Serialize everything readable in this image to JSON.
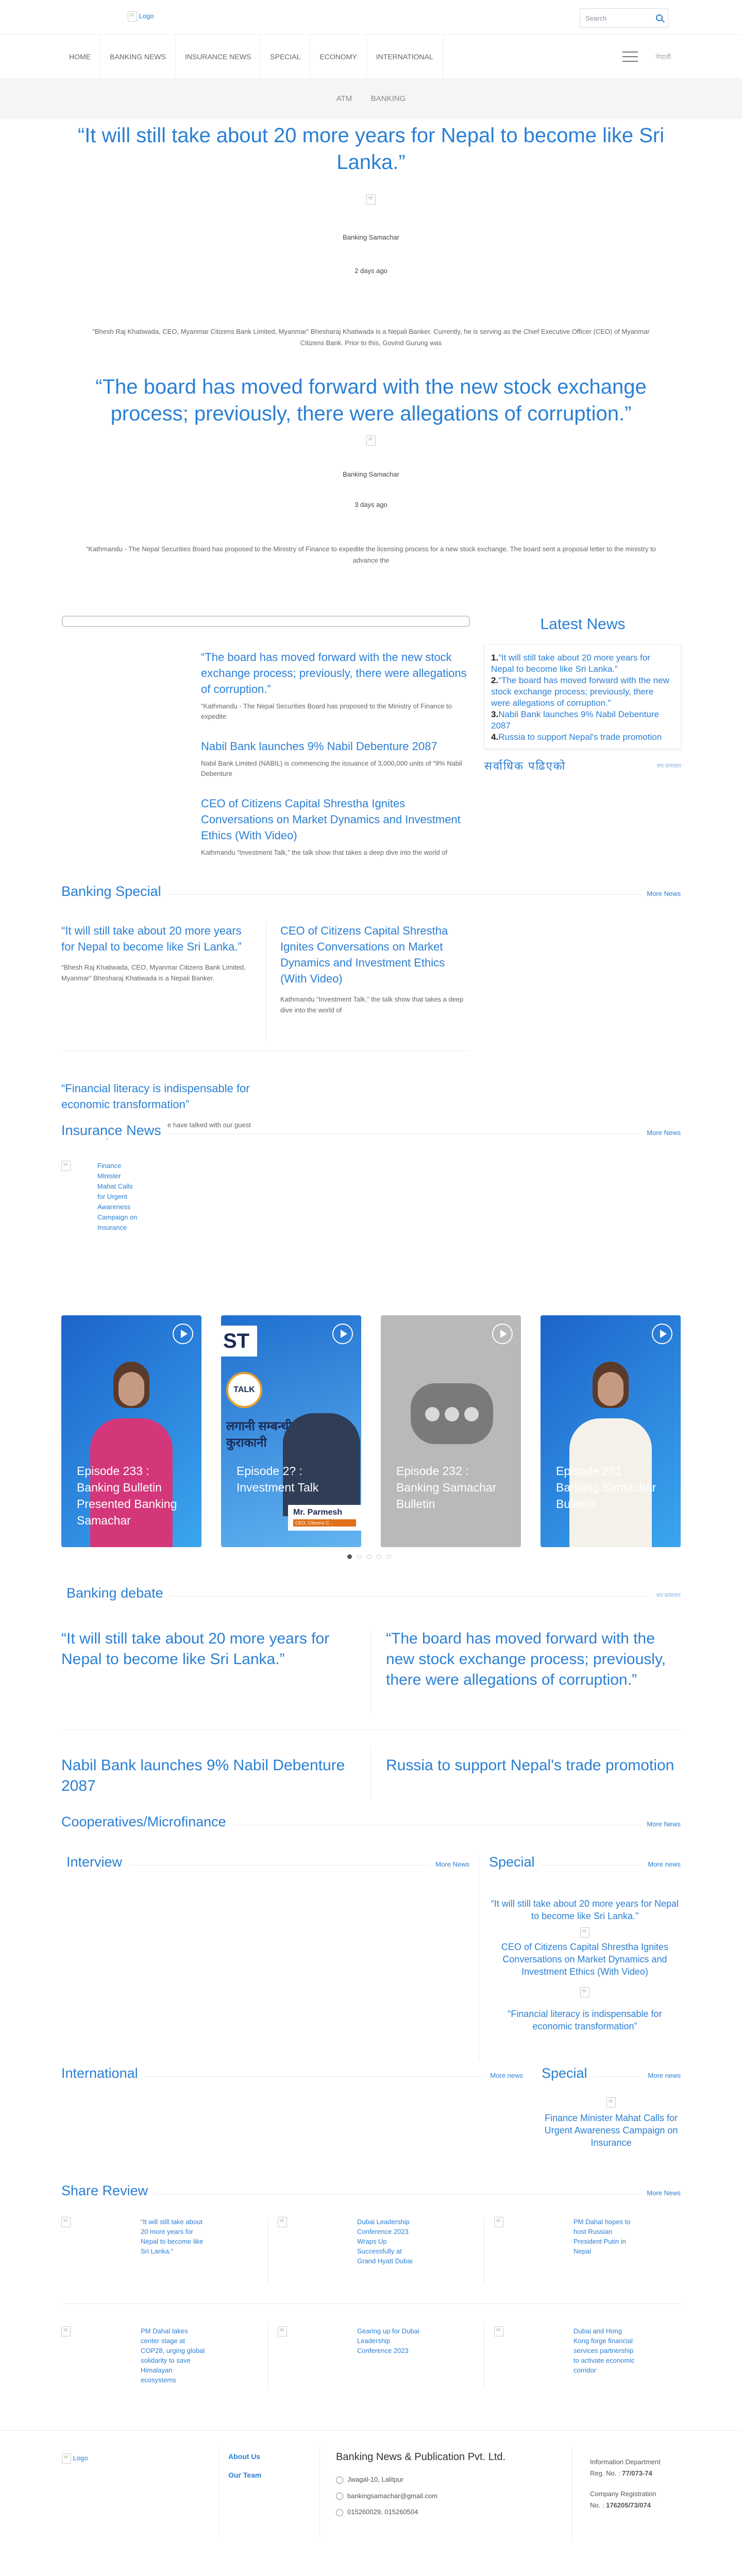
{
  "header": {
    "logo_alt": "Logo",
    "search_placeholder": "Search",
    "nav": [
      "HOME",
      "BANKING NEWS",
      "INSURANCE NEWS",
      "SPECIAL",
      "ECONOMY",
      "INTERNATIONAL"
    ],
    "lang": "नेपाली",
    "subnav": [
      "ATM",
      "BANKING"
    ]
  },
  "quotes": [
    {
      "title": "“It will still take about 20 more years for Nepal to become like Sri Lanka.”",
      "author": "Banking Samachar",
      "date": "2 days ago",
      "excerpt": "“Bhesh Raj Khatiwada, CEO, Myanmar Citizens Bank Limited, Myanmar” Bhesharaj Khatiwada is a Nepali Banker. Currently, he is serving as the Chief Executive Officer (CEO) of Myanmar Citizens Bank. Prior to this, Govind Gurung was"
    },
    {
      "title": "“The board has moved forward with the new stock exchange process; previously, there were allegations of corruption.”",
      "author": "Banking Samachar",
      "date": "3 days ago",
      "excerpt": "“Kathmandu - The Nepal Securities Board has proposed to the Ministry of Finance to expedite the licensing process for a new stock exchange. The board sent a proposal letter to the ministry to advance the"
    }
  ],
  "latest": {
    "list": [
      {
        "title": "“The board has moved forward with the new stock exchange process; previously, there were allegations of corruption.”",
        "excerpt": "“Kathmandu - The Nepal Securities Board has proposed to the Ministry of Finance to expedite"
      },
      {
        "title": "Nabil Bank launches 9% Nabil Debenture 2087",
        "excerpt": "Nabil Bank Limited (NABIL) is commencing the issuance of 3,000,000 units of \"9% Nabil Debenture"
      },
      {
        "title": "CEO of Citizens Capital Shrestha Ignites Conversations on Market Dynamics and Investment Ethics (With Video)",
        "excerpt": "Kathmandu “Investment Talk,” the talk show that takes a deep dive into the world of"
      }
    ],
    "heading": "Latest News",
    "side": [
      {
        "num": "1.",
        "text": "“It will still take about 20 more years for Nepal to become like Sri Lanka.”"
      },
      {
        "num": "2.",
        "text": "“The board has moved forward with the new stock exchange process; previously, there were allegations of corruption.”"
      },
      {
        "num": "3.",
        "text": "Nabil Bank launches 9% Nabil Debenture 2087"
      },
      {
        "num": "4.",
        "text": "Russia to support Nepal's trade promotion"
      }
    ],
    "foot_dev": "सर्वाधिक पढिएको",
    "foot_small": "थप समाचार"
  },
  "banking_special": {
    "heading": "Banking Special",
    "more": "More News",
    "cards": [
      {
        "title": "“It will still take about 20 more years for Nepal to become like Sri Lanka.”",
        "excerpt": "“Bhesh Raj Khatiwada, CEO, Myanmar Citizens Bank Limited, Myanmar” Bhesharaj Khatiwada is a Nepali Banker."
      },
      {
        "title": "CEO of Citizens Capital Shrestha Ignites Conversations on Market Dynamics and Investment Ethics (With Video)",
        "excerpt": "Kathmandu “Investment Talk,” the talk show that takes a deep dive into the world of"
      },
      {
        "title": "“Financial literacy is indispensable for economic transformation”",
        "excerpt": "In this episode of Banking Bahas, we have talked with our guest Mr. Anil Keshary"
      }
    ]
  },
  "insurance": {
    "heading": "Insurance News",
    "more": "More News",
    "item": "Finance Minister Mahat Calls for Urgent Awareness Campaign on Insurance"
  },
  "videos": [
    {
      "title": "Episode 233 : Banking Bulletin Presented Banking Samachar"
    },
    {
      "title": "Episode 2? : Investment Talk",
      "banner": "ST",
      "talk": "TALK",
      "dev": "लगानी सम्बन्धी कुराकानी",
      "name": "Mr. Parmesh",
      "role": "CEO, Citizens C..."
    },
    {
      "title": "Episode 232 : Banking Samachar Bulletin"
    },
    {
      "title": "Episode 231 : Banking Samachar Bulletin"
    }
  ],
  "debate": {
    "heading": "Banking debate",
    "more": "थप समाचार",
    "items": [
      "“It will still take about 20 more years for Nepal to become like Sri Lanka.”",
      "“The board has moved forward with the new stock exchange process; previously, there were allegations of corruption.”",
      "Nabil Bank launches 9% Nabil Debenture 2087",
      "Russia to support Nepal's trade promotion"
    ]
  },
  "coop": {
    "heading": "Cooperatives/Microfinance",
    "more": "More News"
  },
  "interview": {
    "heading": "Interview",
    "more": "More News"
  },
  "special_box": {
    "heading": "Special",
    "more": "More news",
    "items": [
      "“It will still take about 20 more years for Nepal to become like Sri Lanka.”",
      "CEO of Citizens Capital Shrestha Ignites Conversations on Market Dynamics and Investment Ethics (With Video)",
      "“Financial literacy is indispensable for economic transformation”"
    ]
  },
  "international": {
    "heading": "International",
    "more": "More news"
  },
  "special2": {
    "heading": "Special",
    "more": "More news",
    "item": "Finance Minister Mahat Calls for Urgent Awareness Campaign on Insurance"
  },
  "share_review": {
    "heading": "Share Review",
    "more": "More News",
    "items": [
      "“It will still take about 20 more years for Nepal to become like Sri Lanka.”",
      "Dubai Leadership Conference 2023 Wraps Up Successfully at Grand Hyatt Dubai",
      "PM Dahal hopes to host Russian President Putin in Nepal",
      "PM Dahal takes center stage at COP28, urging global solidarity to save Himalayan ecosystems",
      "Gearing up for Dubai Leadership Conference 2023",
      "Dubai and Hong Kong forge financial services partnership to activate economic corridor"
    ]
  },
  "footer": {
    "logo_alt": "Logo",
    "links": [
      "About Us",
      "Our Team"
    ],
    "company": "Banking News & Publication Pvt. Ltd.",
    "address": "Jwagal-10, Lalitpur",
    "email": "bankingsamachar@gmail.com",
    "phone": "015260029, 015260504",
    "info_dept": "Information Department",
    "reg_label": "Reg. No. :",
    "reg_no": "77/073-74",
    "company_reg": "Company Registration",
    "company_reg_label": "No. :",
    "company_reg_no": "176205/73/074"
  }
}
